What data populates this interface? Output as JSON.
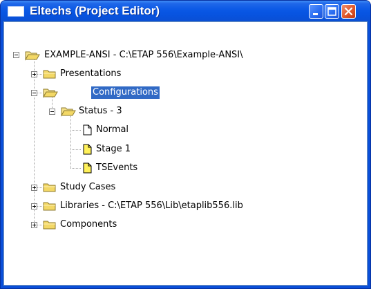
{
  "window": {
    "title": "Eltechs (Project Editor)",
    "buttons": {
      "minimize_icon": "minimize-icon",
      "maximize_icon": "maximize-icon",
      "close_icon": "close-icon"
    }
  },
  "tree": {
    "root": {
      "label": "EXAMPLE-ANSI - C:\\ETAP 556\\Example-ANSI\\",
      "icon": "open-folder-icon",
      "expanded": true
    },
    "presentations": {
      "label": "Presentations",
      "icon": "folder-icon",
      "expanded": false
    },
    "configurations": {
      "label": "Configurations",
      "icon": "open-folder-icon",
      "expanded": true,
      "selected": true
    },
    "status": {
      "label": "Status - 3",
      "icon": "open-folder-icon",
      "expanded": true
    },
    "normal": {
      "label": "Normal",
      "icon": "document-icon"
    },
    "stage1": {
      "label": "Stage 1",
      "icon": "yellow-document-icon"
    },
    "tsevents": {
      "label": "TSEvents",
      "icon": "yellow-document-icon"
    },
    "study_cases": {
      "label": "Study Cases",
      "icon": "folder-icon",
      "expanded": false
    },
    "libraries": {
      "label": "Libraries - C:\\ETAP 556\\Lib\\etaplib556.lib",
      "icon": "folder-icon",
      "expanded": false
    },
    "components": {
      "label": "Components",
      "icon": "folder-icon",
      "expanded": false
    }
  },
  "colors": {
    "titlebar": "#0a58e5",
    "selection": "#316ac5",
    "folder": "#f3d866",
    "close_button": "#e0572a"
  }
}
